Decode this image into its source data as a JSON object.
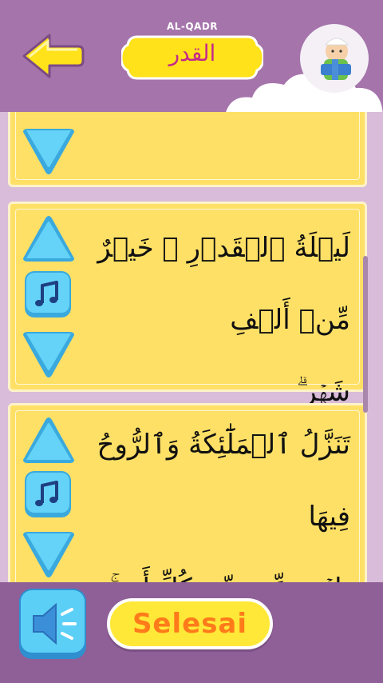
{
  "header": {
    "title_latin": "AL-QADR",
    "title_arabic": "القدر",
    "back_icon": "back-arrow-icon",
    "avatar_icon": "child-reader-icon"
  },
  "verses": [
    {
      "lines": []
    },
    {
      "lines": [
        "لَيۡلَةُ ٱلۡقَدۡرِ ۙ خَيۡرٌ مِّنۡ أَلۡفِ",
        "شَهۡرٍ ۗ"
      ]
    },
    {
      "lines": [
        "تَنَزَّلُ ٱلۡمَلَٰٓئِكَةُ وَٱلرُّوحُ فِيهَا",
        "بِإِذۡنِ رَبِّهِم مِّن كُلِّ أَمۡرٍ ۚ"
      ]
    }
  ],
  "controls": {
    "prev_icon": "triangle-up-icon",
    "next_icon": "triangle-down-icon",
    "play_icon": "music-note-icon"
  },
  "footer": {
    "speaker_icon": "speaker-icon",
    "finish_label": "Selesai"
  },
  "colors": {
    "header_bg": "#a574ab",
    "card_bg": "#ffe066",
    "button_blue": "#4fc3f0",
    "title_pink": "#c42a8a",
    "finish_orange": "#ff7a1a"
  }
}
